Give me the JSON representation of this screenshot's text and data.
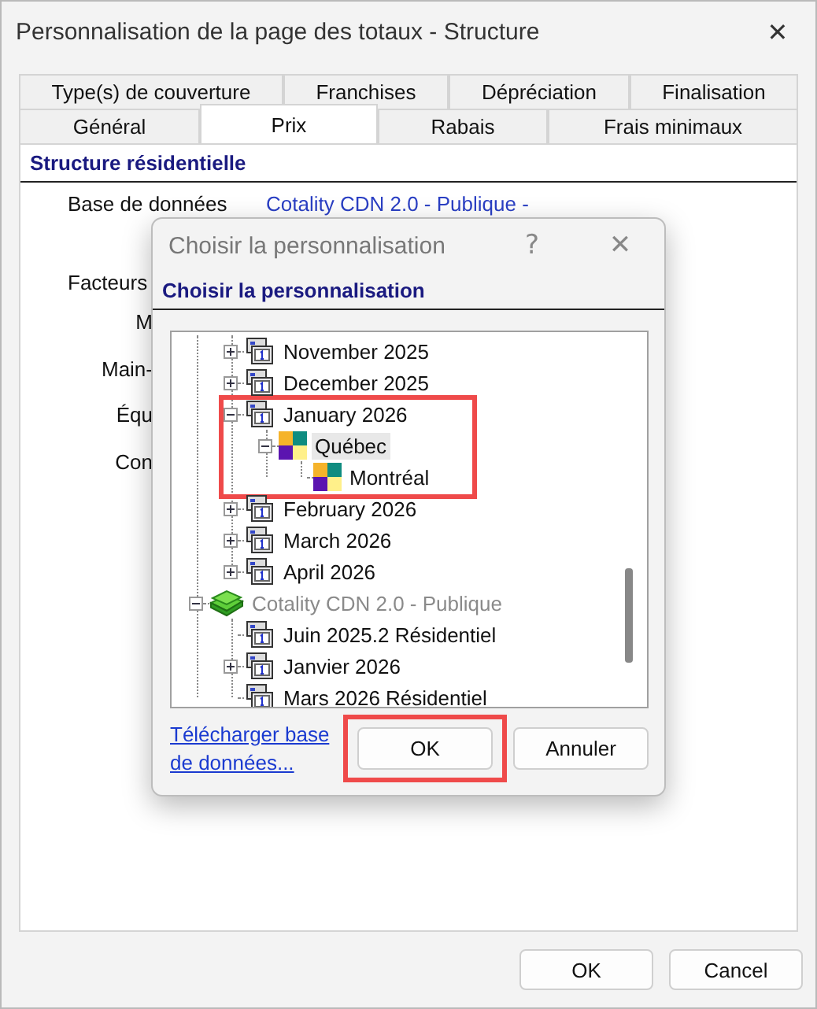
{
  "window": {
    "title": "Personnalisation de la page des totaux - Structure",
    "close": "✕"
  },
  "tabs": [
    [
      {
        "label": "Type(s) de couverture",
        "selected": false
      },
      {
        "label": "Franchises",
        "selected": false
      },
      {
        "label": "Dépréciation",
        "selected": false
      },
      {
        "label": "Finalisation",
        "selected": false
      }
    ],
    [
      {
        "label": "Général",
        "selected": false
      },
      {
        "label": "Prix",
        "selected": true
      },
      {
        "label": "Rabais",
        "selected": false
      },
      {
        "label": "Frais minimaux",
        "selected": false
      }
    ]
  ],
  "panel": {
    "heading": "Structure résidentielle",
    "database": {
      "label": "Base de données",
      "value": "Cotality CDN 2.0 - Publique -"
    },
    "factors_label": "Facteurs",
    "factor_labels": [
      "M",
      "Main-",
      "Équ",
      "Con"
    ]
  },
  "dialog": {
    "title": "Choisir la personnalisation",
    "help": "?",
    "close": "✕",
    "heading": "Choisir la personnalisation",
    "tree": [
      {
        "children": [
          {
            "kind": "version",
            "label": "November 2025",
            "expanded": false,
            "selected": false,
            "disabled": false,
            "highlighted": false
          },
          {
            "kind": "version",
            "label": "December 2025",
            "expanded": false,
            "selected": false,
            "disabled": false,
            "highlighted": false
          },
          {
            "kind": "version",
            "label": "January 2026",
            "expanded": true,
            "selected": false,
            "disabled": false,
            "highlighted": true,
            "children": [
              {
                "kind": "region",
                "label": "Québec",
                "expanded": true,
                "selected": true,
                "disabled": false,
                "highlighted": false,
                "children": [
                  {
                    "kind": "region",
                    "label": "Montréal",
                    "selected": false,
                    "disabled": false,
                    "highlighted": false
                  }
                ]
              }
            ]
          },
          {
            "kind": "version",
            "label": "February 2026",
            "expanded": false,
            "selected": false,
            "disabled": false,
            "highlighted": false
          },
          {
            "kind": "version",
            "label": "March 2026",
            "expanded": false,
            "selected": false,
            "disabled": false,
            "highlighted": false
          },
          {
            "kind": "version",
            "label": "April 2026",
            "expanded": false,
            "selected": false,
            "disabled": false,
            "highlighted": false
          }
        ]
      },
      {
        "kind": "database",
        "label": "Cotality CDN 2.0 - Publique",
        "expanded": true,
        "selected": false,
        "disabled": true,
        "highlighted": false,
        "children": [
          {
            "kind": "version",
            "label": "Juin 2025.2 Résidentiel",
            "selected": false,
            "disabled": false,
            "highlighted": false
          },
          {
            "kind": "version",
            "label": "Janvier 2026",
            "expanded": false,
            "selected": false,
            "disabled": false,
            "highlighted": false
          },
          {
            "kind": "version",
            "label": "Mars 2026 Résidentiel",
            "selected": false,
            "disabled": false,
            "highlighted": false
          }
        ]
      }
    ],
    "link": "Télécharger base de données...",
    "buttons": [
      {
        "label": "OK",
        "highlighted": true
      },
      {
        "label": "Annuler",
        "highlighted": false
      }
    ]
  },
  "buttons": [
    "OK",
    "Cancel"
  ]
}
